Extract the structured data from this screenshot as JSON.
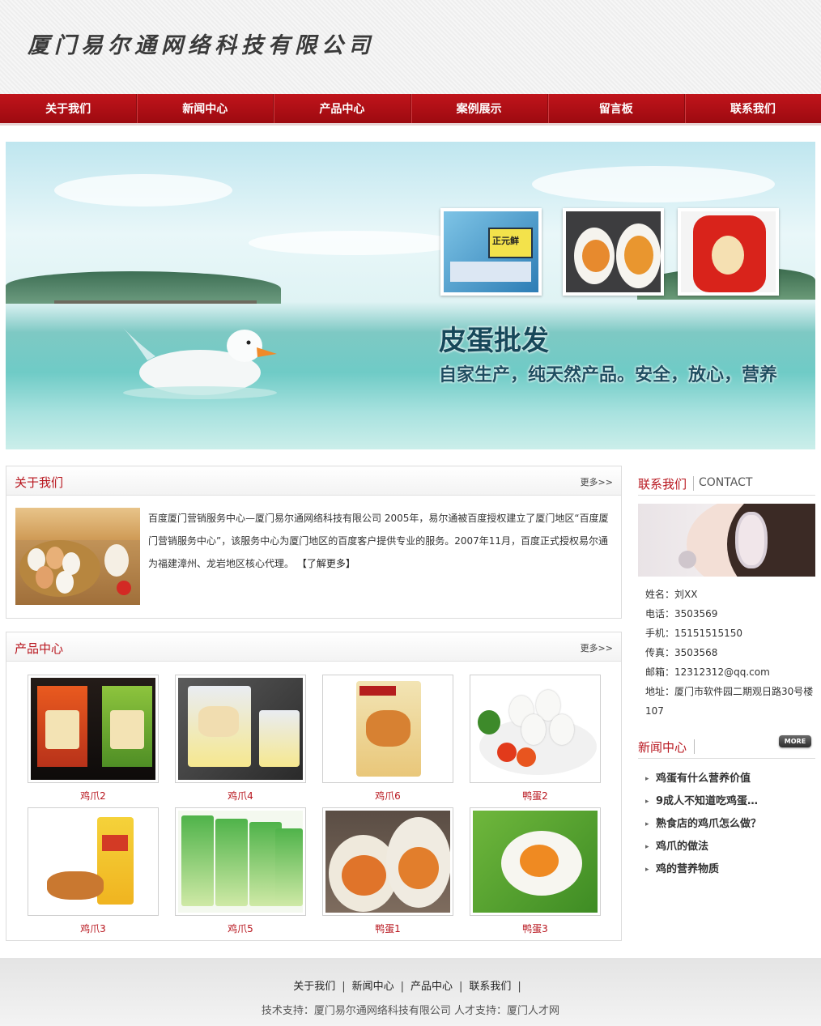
{
  "header": {
    "company_name": "厦门易尔通网络科技有限公司"
  },
  "nav": {
    "items": [
      "关于我们",
      "新闻中心",
      "产品中心",
      "案例展示",
      "留言板",
      "联系我们"
    ]
  },
  "banner": {
    "title": "皮蛋批发",
    "subtitle": "自家生产，纯天然产品。安全，放心，营养",
    "photos": [
      "正元鲜",
      "咸蛋",
      "卤蛋"
    ]
  },
  "about": {
    "title": "关于我们",
    "more": "更多>>",
    "text": "百度厦门营销服务中心—厦门易尔通网络科技有限公司 2005年，易尔通被百度授权建立了厦门地区“百度厦门营销服务中心”，该服务中心为厦门地区的百度客户提供专业的服务。2007年11月，百度正式授权易尔通为福建漳州、龙岩地区核心代理。",
    "learn_more": "【了解更多】"
  },
  "products": {
    "title": "产品中心",
    "more": "更多>>",
    "items": [
      {
        "name": "鸡爪2"
      },
      {
        "name": "鸡爪4"
      },
      {
        "name": "鸡爪6"
      },
      {
        "name": "鸭蛋2"
      },
      {
        "name": "鸡爪3"
      },
      {
        "name": "鸡爪5"
      },
      {
        "name": "鸭蛋1"
      },
      {
        "name": "鸭蛋3"
      }
    ]
  },
  "contact": {
    "title": "联系我们",
    "title_en": "CONTACT",
    "name": "姓名：刘XX",
    "phone": "电话：3503569",
    "mobile": "手机：15151515150",
    "fax": "传真：3503568",
    "email": "邮箱：12312312@qq.com",
    "address": "地址：厦门市软件园二期观日路30号楼107"
  },
  "news": {
    "title": "新闻中心",
    "more": "MORE",
    "items": [
      "鸡蛋有什么营养价值",
      "9成人不知道吃鸡蛋…",
      "熟食店的鸡爪怎么做？",
      "鸡爪的做法",
      "鸡的营养物质"
    ]
  },
  "footer": {
    "links": [
      "关于我们",
      "新闻中心",
      "产品中心",
      "联系我们"
    ],
    "credit": "技术支持：厦门易尔通网络科技有限公司  人才支持：厦门人才网"
  }
}
